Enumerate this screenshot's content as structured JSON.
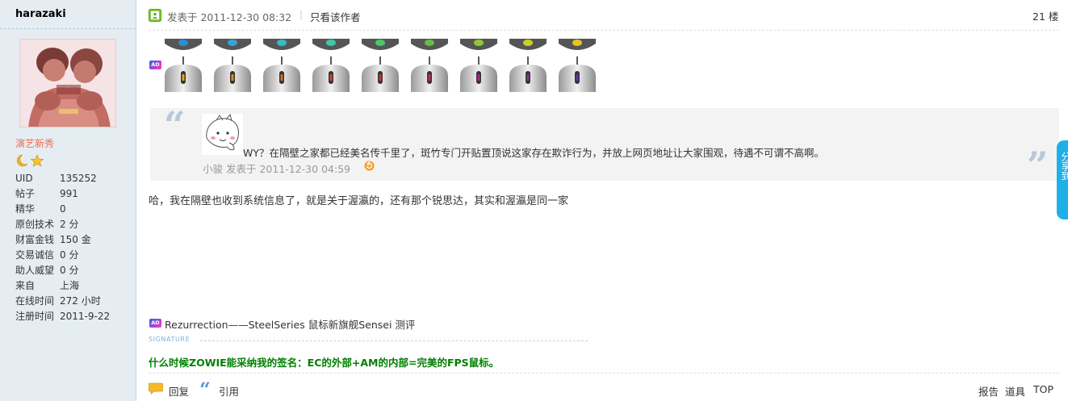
{
  "user": {
    "name": "harazaki",
    "group": "演艺新秀",
    "stats": [
      {
        "label": "UID",
        "value": "135252"
      },
      {
        "label": "帖子",
        "value": "991"
      },
      {
        "label": "精华",
        "value": "0"
      },
      {
        "label": "原创技术",
        "value": "2 分"
      },
      {
        "label": "财富金钱",
        "value": "150 金"
      },
      {
        "label": "交易诚信",
        "value": "0 分"
      },
      {
        "label": "助人威望",
        "value": "0 分"
      },
      {
        "label": "来自",
        "value": "上海"
      },
      {
        "label": "在线时间",
        "value": "272 小时"
      },
      {
        "label": "注册时间",
        "value": "2011-9-22"
      }
    ]
  },
  "post": {
    "time": "发表于 2011-12-30 08:32",
    "separator": "|",
    "only_author": "只看该作者",
    "floor": "21 楼",
    "ad_badge": "AD",
    "quote": {
      "text": "WY？在隔壁之家都已经美名传千里了，斑竹专门开贴置顶说这家存在欺诈行为，并放上网页地址让大家围观，待遇不可谓不高啊。",
      "meta": "小骏 发表于 2011-12-30 04:59"
    },
    "body": "哈，我在隔壁也收到系统信息了，就是关于渥瀛的，还有那个锐思达，其实和渥瀛是同一家",
    "ad_link": "Rezurrection——SteelSeries 鼠标新旗舰Sensei 测评",
    "signature_label": "SIGNATURE",
    "signature": "什么时候ZOWIE能采纳我的签名：EC的外部+AM的内部=完美的FPS鼠标。"
  },
  "actions": {
    "reply": "回复",
    "quote": "引用",
    "report": "报告",
    "tools": "道具",
    "top": "TOP"
  },
  "side_tab": {
    "label": "分享到"
  },
  "colors": {
    "sidebar_bg": "#e5edf2",
    "group_color": "#f26c4f",
    "signature_color": "#008000",
    "share_tab": "#1fb0e8"
  }
}
